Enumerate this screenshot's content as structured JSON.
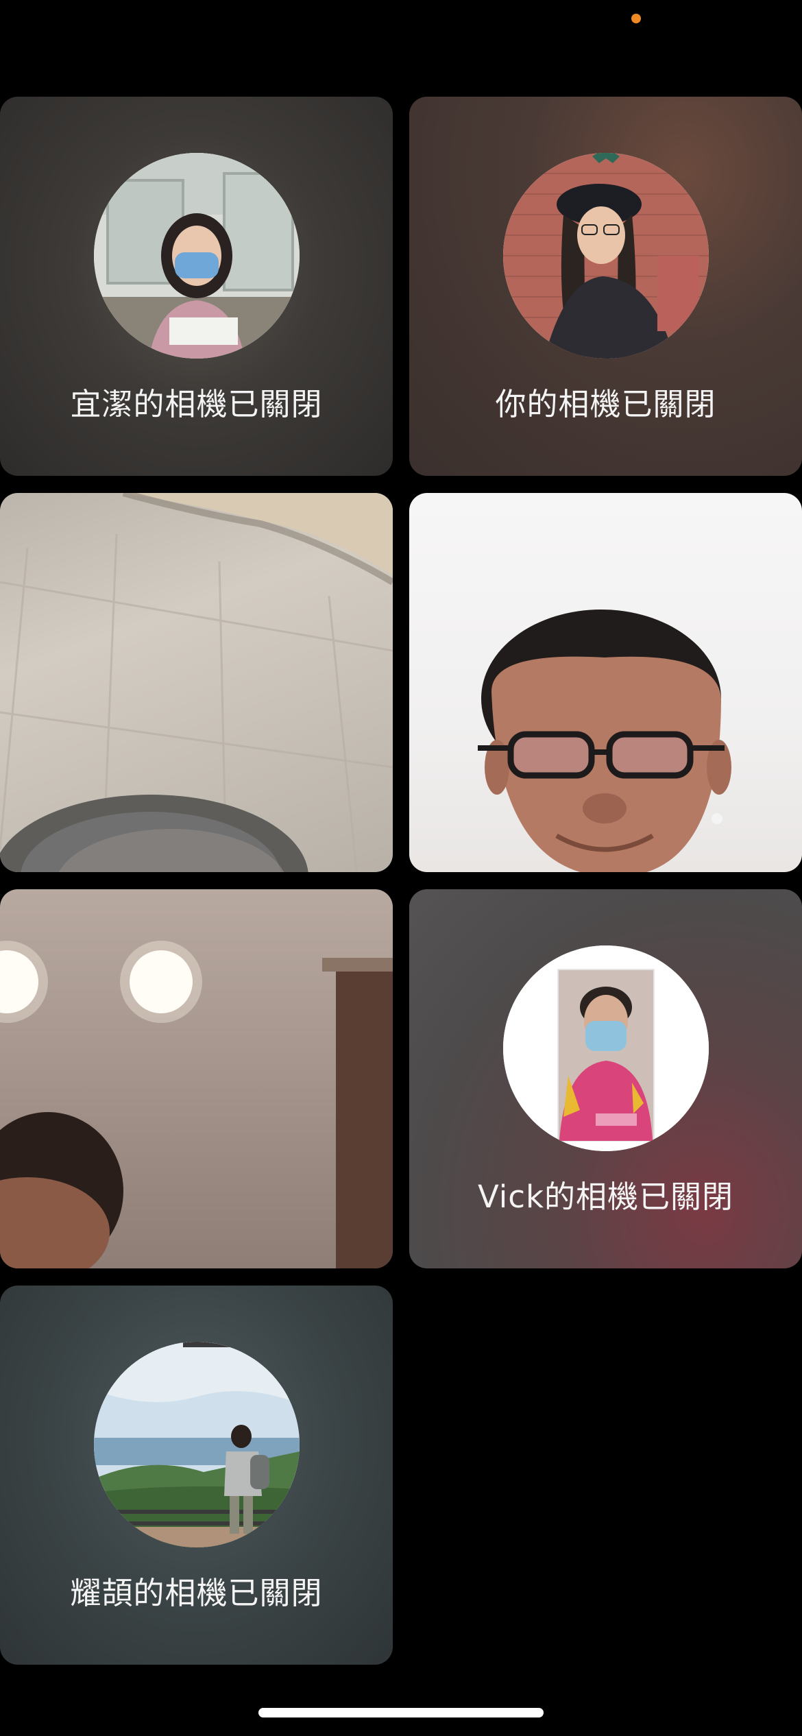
{
  "status_bar": {
    "indicator_color": "#f08a24"
  },
  "participants": [
    {
      "label": "宜潔的相機已關閉",
      "camera": "off",
      "avatar": "photo-girl-with-mask"
    },
    {
      "label": "你的相機已關閉",
      "camera": "off",
      "avatar": "photo-girl-with-hat"
    },
    {
      "label": "",
      "camera": "on",
      "video": "ceiling-view"
    },
    {
      "label": "",
      "camera": "on",
      "video": "smiling-man-with-glasses"
    },
    {
      "label": "",
      "camera": "on",
      "video": "room-with-ceiling-lights"
    },
    {
      "label": "Vick的相機已關閉",
      "camera": "off",
      "avatar": "photo-man-with-mask-pink-vest"
    },
    {
      "label": "耀頡的相機已關閉",
      "camera": "off",
      "avatar": "photo-man-on-mountain"
    }
  ]
}
